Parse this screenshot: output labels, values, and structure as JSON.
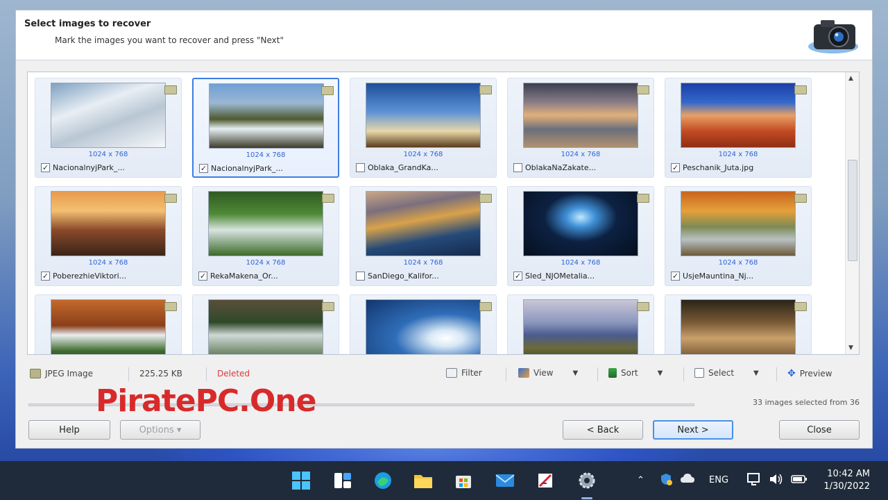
{
  "header": {
    "title": "Select images to recover",
    "subtitle": "Mark the images you want to recover and press \"Next\""
  },
  "tiles": [
    {
      "dims": "1024 x 768",
      "name": "NacionalnyjPark_...",
      "checked": "✓"
    },
    {
      "dims": "1024 x 768",
      "name": "NacionalnyjPark_...",
      "checked": "✓"
    },
    {
      "dims": "1024 x 768",
      "name": "Oblaka_GrandKa...",
      "checked": ""
    },
    {
      "dims": "1024 x 768",
      "name": "OblakaNaZakate...",
      "checked": ""
    },
    {
      "dims": "1024 x 768",
      "name": "Peschanik_Juta.jpg",
      "checked": "✓"
    },
    {
      "dims": "1024 x 768",
      "name": "PoberezhieViktori...",
      "checked": "✓"
    },
    {
      "dims": "1024 x 768",
      "name": "RekaMakena_Or...",
      "checked": "✓"
    },
    {
      "dims": "1024 x 768",
      "name": "SanDiego_Kalifor...",
      "checked": ""
    },
    {
      "dims": "1024 x 768",
      "name": "Sled_NJOMetalia...",
      "checked": "✓"
    },
    {
      "dims": "1024 x 768",
      "name": "UsjeMauntina_Nj...",
      "checked": "✓"
    },
    {
      "dims": "",
      "name": "",
      "checked": ""
    },
    {
      "dims": "",
      "name": "",
      "checked": ""
    },
    {
      "dims": "",
      "name": "",
      "checked": ""
    },
    {
      "dims": "",
      "name": "",
      "checked": ""
    },
    {
      "dims": "",
      "name": "",
      "checked": ""
    }
  ],
  "status": {
    "type": "JPEG Image",
    "size": "225.25 KB",
    "state": "Deleted"
  },
  "toolbar": {
    "filter": "Filter",
    "view": "View",
    "sort": "Sort",
    "select": "Select",
    "preview": "Preview"
  },
  "selection_count": "33 images selected from 36",
  "progress_fraction": 0,
  "buttons": {
    "help": "Help",
    "options": "Options ▾",
    "back": "< Back",
    "next": "Next >",
    "close": "Close"
  },
  "watermark": "PiratePC.One",
  "taskbar": {
    "language": "ENG",
    "time": "10:42 AM",
    "date": "1/30/2022"
  },
  "colors": {
    "accent": "#3d7de0",
    "deleted": "#e03a3a",
    "watermark": "#d82a2a"
  }
}
